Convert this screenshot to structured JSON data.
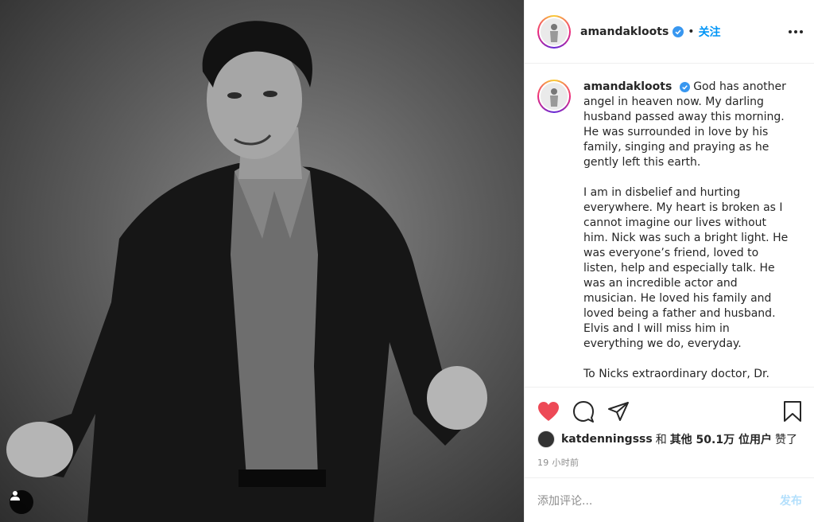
{
  "post": {
    "username": "amandakloots",
    "follow_label": "关注",
    "dot": "•",
    "caption_paragraphs": [
      "God has another angel in heaven now. My darling husband passed away this morning. He was surrounded in love by his family, singing and praying as he gently left this earth.",
      "I am in disbelief and hurting everywhere. My heart is broken as I cannot imagine our lives without him. Nick was such a bright light. He was everyone’s friend, loved to listen, help and especially talk. He was an incredible actor and musician. He loved his family and loved being a father and husband. Elvis and I will miss him in everything we do, everyday.",
      "To Nicks extraordinary doctor, Dr."
    ]
  },
  "likes": {
    "first_user": "katdenningsss",
    "and": "和",
    "others_label": "其他 50.1万 位用户",
    "liked": "赞了"
  },
  "timestamp": "19 小时前",
  "comment": {
    "placeholder": "添加评论...",
    "post_label": "发布"
  },
  "icons": {
    "like": "heart-icon",
    "comment": "comment-icon",
    "share": "share-icon",
    "save": "bookmark-icon",
    "more": "more-icon",
    "verified": "verified-badge-icon",
    "tag": "user-tag-icon"
  },
  "colors": {
    "accent": "#0095f6",
    "like_red": "#ed4956",
    "muted": "#8e8e8e",
    "post_disabled": "#b2dffc"
  }
}
